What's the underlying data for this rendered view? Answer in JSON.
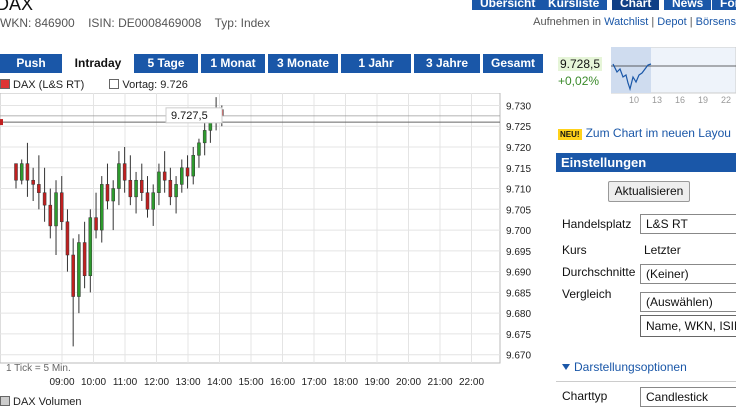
{
  "header": {
    "title": "DAX",
    "wkn": "WKN: 846900",
    "isin": "ISIN: DE0008469008",
    "typ": "Typ: Index",
    "top_tabs": [
      "Übersicht",
      "Kursliste",
      "Chart",
      "News",
      "For"
    ],
    "links_prefix": "Aufnehmen in",
    "links": [
      "Watchlist",
      "Depot",
      "Börsens"
    ]
  },
  "period_tabs": [
    "Push",
    "Intraday",
    "5 Tage",
    "1 Monat",
    "3 Monate",
    "1 Jahr",
    "3 Jahre",
    "Gesamt"
  ],
  "legend": {
    "series": "DAX (L&S RT)",
    "prev": "Vortag: 9.726"
  },
  "chart_note": "1 Tick = 5 Min.",
  "current_label": "9.727,5",
  "volume_label": "DAX Volumen",
  "sidebar": {
    "price": "9.728,5",
    "change": "+0,02%",
    "mini_ticks": [
      "10",
      "13",
      "16",
      "19",
      "22"
    ],
    "neu_badge": "NEU!",
    "neu_link": "Zum Chart im neuen Layou",
    "settings_title": "Einstellungen",
    "refresh_button": "Aktualisieren",
    "handelsplatz_label": "Handelsplatz",
    "handelsplatz_value": "L&S RT",
    "kurs_label": "Kurs",
    "kurs_value": "Letzter",
    "durchschnitte_label": "Durchschnitte",
    "durchschnitte_value": "(Keiner)",
    "vergleich_label": "Vergleich",
    "vergleich_value": "(Auswählen)",
    "vergleich_input": "Name, WKN, ISIN",
    "options_link": "Darstellungsoptionen",
    "charttyp_label": "Charttyp",
    "charttyp_value": "Candlestick"
  },
  "chart_data": {
    "type": "candlestick",
    "x_ticks": [
      "09:00",
      "10:00",
      "11:00",
      "12:00",
      "13:00",
      "14:00",
      "15:00",
      "16:00",
      "17:00",
      "18:00",
      "19:00",
      "20:00",
      "21:00",
      "22:00"
    ],
    "y_ticks": [
      "9.730",
      "9.725",
      "9.720",
      "9.715",
      "9.710",
      "9.705",
      "9.700",
      "9.695",
      "9.690",
      "9.685",
      "9.680",
      "9.675",
      "9.670"
    ],
    "ylim": [
      9668,
      9733
    ],
    "prev_close": 9726,
    "current": 9727.5,
    "candles": [
      [
        9716,
        9716,
        9710,
        9712
      ],
      [
        9712,
        9717,
        9711,
        9716
      ],
      [
        9716,
        9721,
        9708,
        9712
      ],
      [
        9712,
        9715,
        9707,
        9711
      ],
      [
        9711,
        9718,
        9705,
        9709
      ],
      [
        9709,
        9715,
        9702,
        9706
      ],
      [
        9706,
        9710,
        9698,
        9701
      ],
      [
        9701,
        9712,
        9694,
        9709
      ],
      [
        9709,
        9713,
        9700,
        9702
      ],
      [
        9702,
        9705,
        9690,
        9694
      ],
      [
        9694,
        9698,
        9672,
        9684
      ],
      [
        9684,
        9699,
        9680,
        9697
      ],
      [
        9697,
        9702,
        9686,
        9689
      ],
      [
        9689,
        9705,
        9685,
        9703
      ],
      [
        9703,
        9709,
        9698,
        9700
      ],
      [
        9700,
        9713,
        9697,
        9711
      ],
      [
        9711,
        9716,
        9705,
        9707
      ],
      [
        9707,
        9712,
        9700,
        9710
      ],
      [
        9710,
        9719,
        9706,
        9716
      ],
      [
        9716,
        9720,
        9709,
        9712
      ],
      [
        9712,
        9718,
        9706,
        9708
      ],
      [
        9708,
        9714,
        9704,
        9712
      ],
      [
        9712,
        9716,
        9707,
        9709
      ],
      [
        9709,
        9713,
        9703,
        9705
      ],
      [
        9705,
        9711,
        9701,
        9709
      ],
      [
        9709,
        9716,
        9706,
        9714
      ],
      [
        9714,
        9719,
        9709,
        9712
      ],
      [
        9712,
        9715,
        9706,
        9708
      ],
      [
        9708,
        9713,
        9704,
        9711
      ],
      [
        9711,
        9717,
        9709,
        9715
      ],
      [
        9715,
        9718,
        9710,
        9713
      ],
      [
        9713,
        9720,
        9711,
        9718
      ],
      [
        9718,
        9722,
        9715,
        9721
      ],
      [
        9721,
        9726,
        9718,
        9724
      ],
      [
        9724,
        9729,
        9721,
        9727
      ],
      [
        9727,
        9732,
        9724,
        9729
      ],
      [
        9729,
        9730,
        9725,
        9727.5
      ]
    ]
  }
}
